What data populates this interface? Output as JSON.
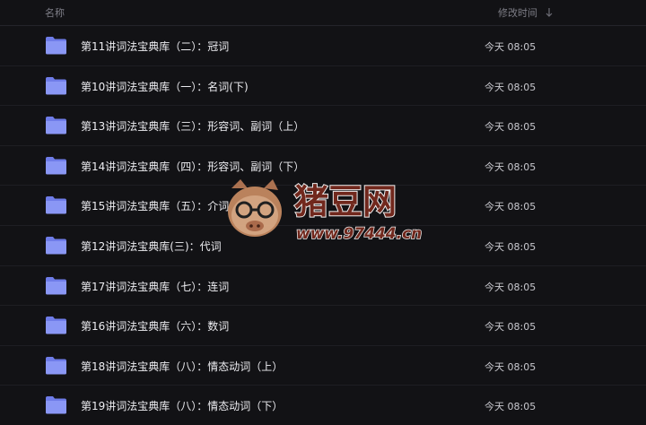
{
  "header": {
    "name_label": "名称",
    "time_label": "修改时间",
    "sort_icon": "arrow-down-icon"
  },
  "files": [
    {
      "name": "第11讲词法宝典库（二）：冠词",
      "time": "今天 08:05",
      "icon": "folder-icon"
    },
    {
      "name": "第10讲词法宝典库（一）：名词(下)",
      "time": "今天 08:05",
      "icon": "folder-icon"
    },
    {
      "name": "第13讲词法宝典库（三）：形容词、副词（上）",
      "time": "今天 08:05",
      "icon": "folder-icon"
    },
    {
      "name": "第14讲词法宝典库（四）：形容词、副词（下）",
      "time": "今天 08:05",
      "icon": "folder-icon"
    },
    {
      "name": "第15讲词法宝典库（五）：介词",
      "time": "今天 08:05",
      "icon": "folder-icon"
    },
    {
      "name": "第12讲词法宝典库(三)：代词",
      "time": "今天 08:05",
      "icon": "folder-icon"
    },
    {
      "name": "第17讲词法宝典库（七）：连词",
      "time": "今天 08:05",
      "icon": "folder-icon"
    },
    {
      "name": "第16讲词法宝典库（六）：数词",
      "time": "今天 08:05",
      "icon": "folder-icon"
    },
    {
      "name": "第18讲词法宝典库（八）：情态动词（上）",
      "time": "今天 08:05",
      "icon": "folder-icon"
    },
    {
      "name": "第19讲词法宝典库（八）：情态动词（下）",
      "time": "今天 08:05",
      "icon": "folder-icon"
    }
  ],
  "watermark": {
    "brand_text": "猪豆网",
    "url_text": "www.97444.cn",
    "brand_color": "#7a2a1e"
  },
  "colors": {
    "background": "#121215",
    "folder": "#8a97f5",
    "folder_tab": "#6f7ce8"
  }
}
